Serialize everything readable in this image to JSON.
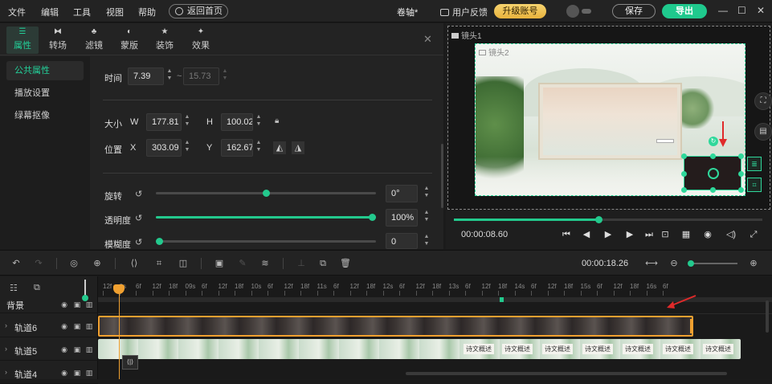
{
  "menu": {
    "file": "文件",
    "edit": "编辑",
    "tools": "工具",
    "view": "视图",
    "help": "帮助",
    "home": "返回首页"
  },
  "title": "卷轴*",
  "header": {
    "feedback": "用户反馈",
    "upgrade": "升级账号",
    "save": "保存",
    "export": "导出"
  },
  "prop_tabs": [
    "属性",
    "转场",
    "滤镜",
    "蒙版",
    "装饰",
    "效果"
  ],
  "side_nav": [
    "公共属性",
    "播放设置",
    "绿幕抠像"
  ],
  "props": {
    "time_label": "时间",
    "time_value": "7.39",
    "time_sep": "~",
    "time_end": "15.73",
    "size_label": "大小",
    "w_label": "W",
    "w_value": "177.81",
    "h_label": "H",
    "h_value": "100.02",
    "pos_label": "位置",
    "x_label": "X",
    "x_value": "303.09",
    "y_label": "Y",
    "y_value": "162.67",
    "rotate_label": "旋转",
    "rotate_value": "0°",
    "rotate_fraction": 0.5,
    "opacity_label": "透明度",
    "opacity_value": "100%",
    "opacity_fraction": 1.0,
    "blur_label": "模糊度",
    "blur_value": "0",
    "blur_fraction": 0.0
  },
  "preview": {
    "lens1": "镜头1",
    "lens2": "镜头2",
    "time": "00:00:08.60",
    "progress_fraction": 0.47
  },
  "timeline": {
    "time": "00:00:18.26",
    "ruler": [
      "12f",
      "0s",
      "6f",
      "12f",
      "18f",
      "09s",
      "6f",
      "12f",
      "18f",
      "10s",
      "6f",
      "12f",
      "18f",
      "11s",
      "6f",
      "12f",
      "18f",
      "12s",
      "6f",
      "12f",
      "18f",
      "13s",
      "6f",
      "12f",
      "18f",
      "14s",
      "6f",
      "12f",
      "18f",
      "15s",
      "6f",
      "12f",
      "18f",
      "16s",
      "6f"
    ],
    "tracks": [
      {
        "name": "背景"
      },
      {
        "name": "轨道6"
      },
      {
        "name": "轨道5"
      },
      {
        "name": "轨道4"
      }
    ],
    "clip_text": "诗文概述"
  },
  "colors": {
    "accent": "#23c98d",
    "upgrade": "#f0c050",
    "clip_border": "#f0a030"
  }
}
